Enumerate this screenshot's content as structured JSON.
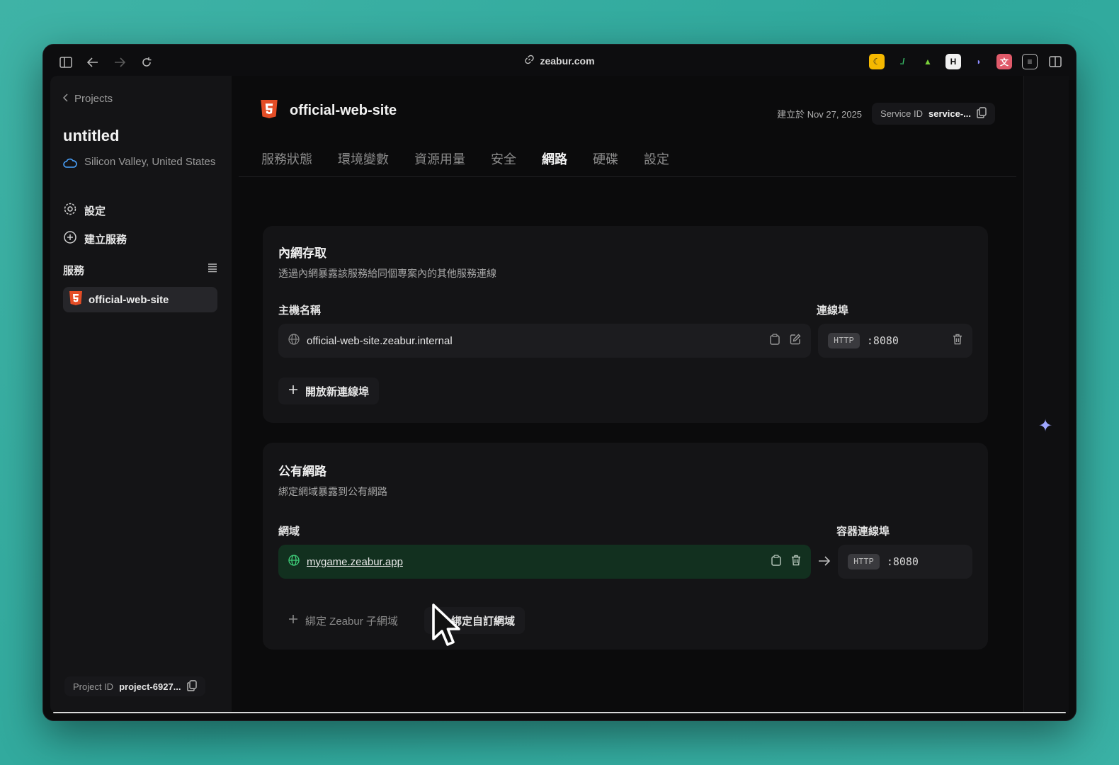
{
  "browser": {
    "url": "zeabur.com"
  },
  "sidebar": {
    "back_label": "Projects",
    "project_title": "untitled",
    "region": "Silicon Valley, United States",
    "settings_label": "設定",
    "create_service_label": "建立服務",
    "services_label": "服務",
    "service_name": "official-web-site",
    "project_id_label": "Project ID",
    "project_id_value": "project-6927..."
  },
  "header": {
    "service_name": "official-web-site",
    "created_at": "建立於 Nov 27, 2025",
    "service_id_label": "Service ID",
    "service_id_value": "service-..."
  },
  "tabs": [
    {
      "label": "服務狀態"
    },
    {
      "label": "環境變數"
    },
    {
      "label": "資源用量"
    },
    {
      "label": "安全"
    },
    {
      "label": "網路"
    },
    {
      "label": "硬碟"
    },
    {
      "label": "設定"
    }
  ],
  "private_network": {
    "title": "內網存取",
    "description": "透過內網暴露該服務給同個專案內的其他服務連線",
    "host_label": "主機名稱",
    "port_label": "連線埠",
    "hostname": "official-web-site.zeabur.internal",
    "protocol": "HTTP",
    "port": ":8080",
    "add_port_label": "開放新連線埠"
  },
  "public_network": {
    "title": "公有網路",
    "description": "綁定網域暴露到公有網路",
    "domain_label": "網域",
    "container_port_label": "容器連線埠",
    "domain": "mygame.zeabur.app",
    "protocol": "HTTP",
    "port": ":8080",
    "bind_subdomain_label": "綁定 Zeabur 子網域",
    "bind_custom_label": "綁定自訂網域"
  },
  "colors": {
    "accent_green": "#12301f",
    "html5_orange": "#e44d26"
  }
}
